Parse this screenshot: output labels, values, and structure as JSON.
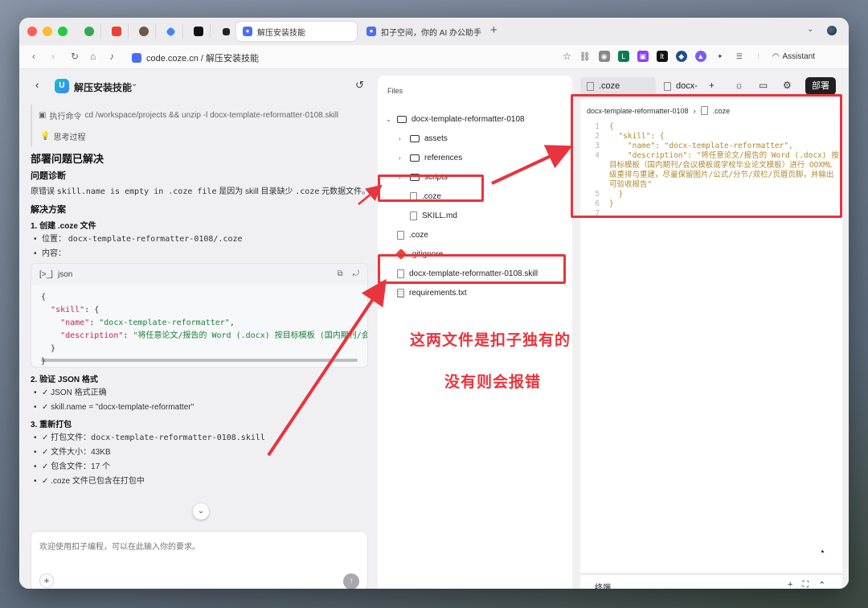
{
  "browser": {
    "tabs": [
      {
        "label": "解压安装技能",
        "active": true
      },
      {
        "label": "扣子空间，你的 AI 办公助手",
        "active": false
      }
    ],
    "url": "code.coze.cn / 解压安装技能",
    "assistant_label": "Assistant"
  },
  "chat": {
    "project_name": "解压安装技能",
    "command_label": "执行命令",
    "command_text": "cd /workspace/projects && unzip -l docx-template-reformatter-0108.skill",
    "thinking_label": "思考过程",
    "heading": "部署问题已解决",
    "diagnosis_title": "问题诊断",
    "diagnosis_pre": "原错误",
    "diagnosis_code1": "skill.name is empty in .coze file",
    "diagnosis_mid": "是因为 skill 目录缺少",
    "diagnosis_code2": ".coze",
    "diagnosis_post": "元数据文件。",
    "solution_title": "解决方案",
    "step1_title": "1. 创建 .coze 文件",
    "step1_location_label": "位置：",
    "step1_location_value": "docx-template-reformatter-0108/.coze",
    "step1_content_label": "内容：",
    "code_lang": "json",
    "code_lines": {
      "l1": "{",
      "l2_key": "\"skill\"",
      "l2_rest": ": {",
      "l3_key": "\"name\"",
      "l3_val": "\"docx-template-reformatter\"",
      "l4_key": "\"description\"",
      "l4_val": "\"将任意论文/报告的 Word (.docx) 按目标模板 (国内期刊/会",
      "l5": "}",
      "l6": "}"
    },
    "step2_title": "2. 验证 JSON 格式",
    "step2_items": [
      "✓ JSON 格式正确",
      "✓ skill.name = \"docx-template-reformatter\""
    ],
    "step3_title": "3. 重新打包",
    "step3_item1_label": "✓ 打包文件：",
    "step3_item1_value": "docx-template-reformatter-0108.skill",
    "step3_items": [
      "✓ 文件大小：43KB",
      "✓ 包含文件：17 个",
      "✓ .coze 文件已包含在打包中"
    ],
    "input_placeholder": "欢迎使用扣子编程，可以在此输入你的要求。"
  },
  "files": {
    "title": "Files",
    "items": [
      {
        "label": "docx-template-reformatter-0108",
        "type": "folder-open"
      },
      {
        "label": "assets",
        "type": "folder"
      },
      {
        "label": "references",
        "type": "folder"
      },
      {
        "label": "scripts",
        "type": "folder"
      },
      {
        "label": ".coze",
        "type": "file"
      },
      {
        "label": "SKILL.md",
        "type": "file"
      },
      {
        "label": ".coze",
        "type": "file"
      },
      {
        "label": ".gitignore",
        "type": "git"
      },
      {
        "label": "docx-template-reformatter-0108.skill",
        "type": "file"
      },
      {
        "label": "requirements.txt",
        "type": "txt"
      }
    ]
  },
  "editor": {
    "tabs": [
      ".coze",
      "docx-"
    ],
    "deploy_label": "部署",
    "breadcrumb_dir": "docx-template-reformatter-0108",
    "breadcrumb_file": ".coze",
    "lines": [
      {
        "n": "1",
        "text": "{"
      },
      {
        "n": "2",
        "text": "  \"skill\": {"
      },
      {
        "n": "3",
        "text": "    \"name\": \"docx-template-reformatter\","
      },
      {
        "n": "4",
        "text": "    \"description\": \"将任意论文/报告的 Word (.docx) 按目标模板（国内期刊/会议模板或学校毕业论文模板）进行 OOXML 级重排与重建，尽量保留图片/公式/分节/双栏/页眉页脚，并输出可验收报告\""
      },
      {
        "n": "5",
        "text": "  }"
      },
      {
        "n": "6",
        "text": "}"
      },
      {
        "n": "7",
        "text": ""
      }
    ],
    "terminal_label": "终端"
  },
  "annotations": {
    "line1": "这两文件是扣子独有的",
    "line2": "没有则会报错",
    "color": "#e8343d"
  }
}
